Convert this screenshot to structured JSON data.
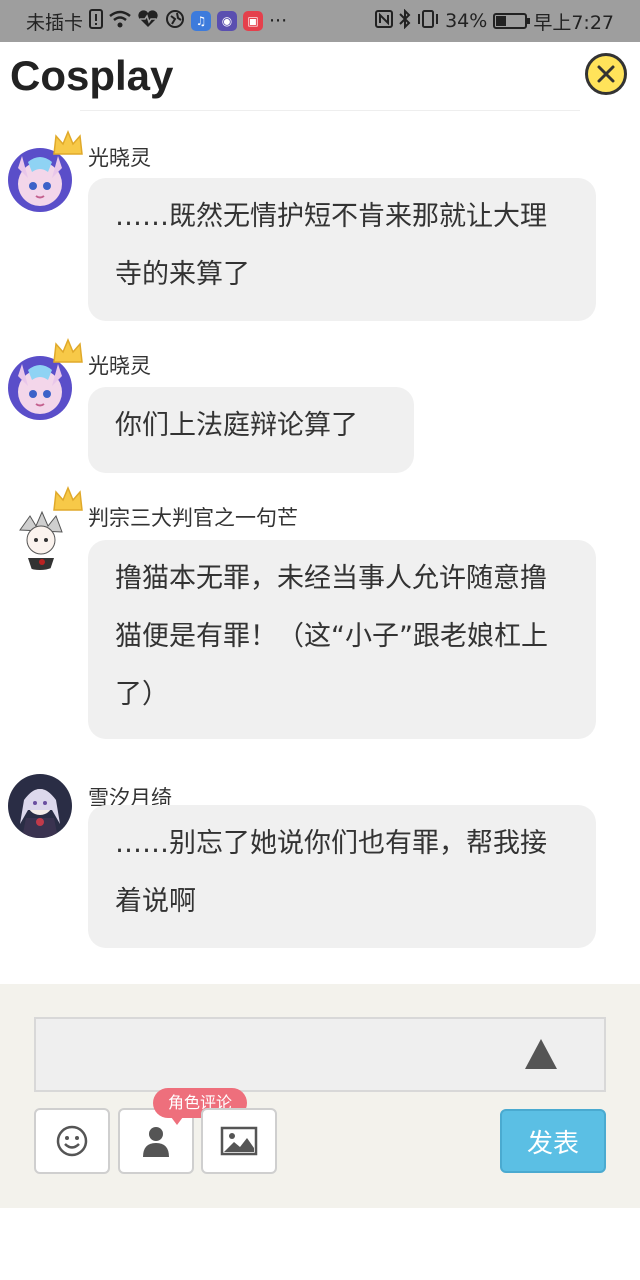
{
  "status_bar": {
    "carrier": "未插卡",
    "more": "···",
    "battery_text": "34%",
    "battery_level": 0.34,
    "time": "早上7:27",
    "icons": [
      "sim-alert-icon",
      "wifi-icon",
      "heart-rate-icon",
      "vpn-icon",
      "music-app-icon",
      "game-app-icon",
      "shop-app-icon",
      "nfc-icon",
      "bluetooth-icon",
      "vibrate-icon",
      "battery-icon"
    ]
  },
  "header": {
    "title": "Cosplay",
    "close_icon": "close-icon"
  },
  "messages": [
    {
      "username": "光晓灵",
      "crown": true,
      "text": "……既然无情护短不肯来那就让大理寺的来算了"
    },
    {
      "username": "光晓灵",
      "crown": true,
      "text": "你们上法庭辩论算了"
    },
    {
      "username": "判宗三大判官之一句芒",
      "crown": true,
      "text": "撸猫本无罪，未经当事人允许随意撸猫便是有罪！（这“小子”跟老娘杠上了）"
    },
    {
      "username": "雪汐月绮",
      "crown": false,
      "text": "……别忘了她说你们也有罪，帮我接着说啊"
    }
  ],
  "composer": {
    "input_value": "",
    "role_tag": "角色评论",
    "post_label": "发表",
    "tools": [
      "emoji-icon",
      "person-icon",
      "image-icon"
    ]
  },
  "colors": {
    "accent": "#5bbfe4",
    "tag": "#ee6f7c",
    "close_bg": "#ffe35a",
    "bubble_bg": "#f0f0f0",
    "composer_bg": "#f3f2ec"
  }
}
